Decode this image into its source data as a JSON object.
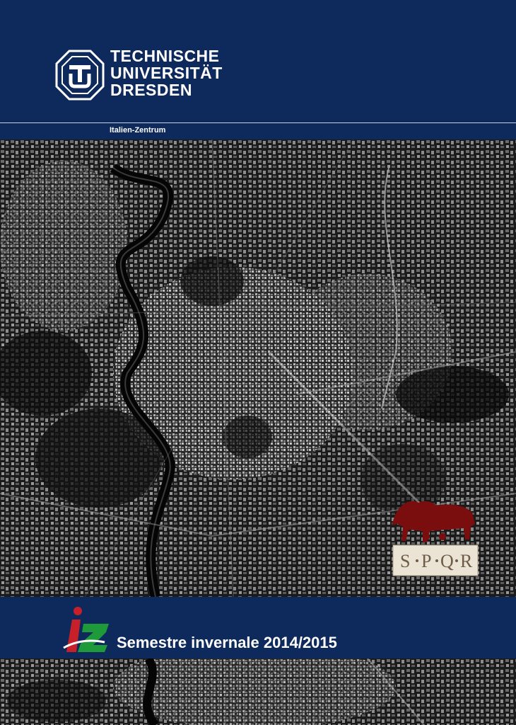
{
  "header": {
    "university_lines": [
      "TECHNISCHE",
      "UNIVERSITÄT",
      "DRESDEN"
    ],
    "department": "Italien-Zentrum"
  },
  "footer": {
    "title": "Semestre invernale 2014/2015"
  },
  "emblem": {
    "letters": [
      "S",
      "P",
      "Q",
      "R"
    ]
  },
  "colors": {
    "brand_blue": "#0e2a5c",
    "iz_red": "#c8202a",
    "iz_green": "#1f9a3a",
    "wolf_red": "#7a0d0d"
  },
  "icons": {
    "university_logo": "tu-dresden-logo-icon",
    "center_logo": "iz-logo-icon",
    "emblem": "capitoline-wolf-spqr-icon"
  }
}
